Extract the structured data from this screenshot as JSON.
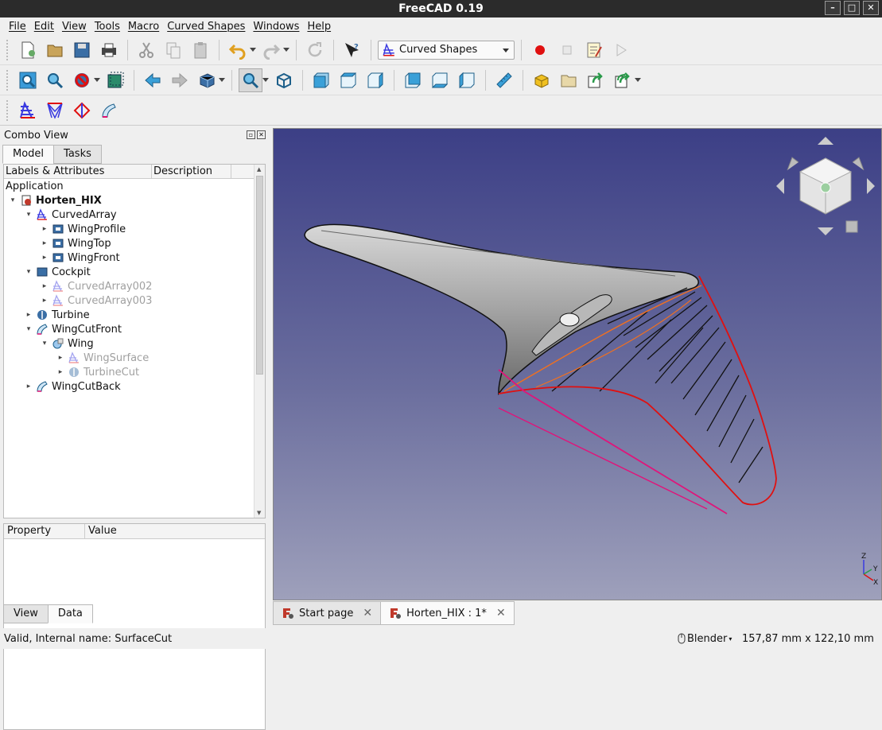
{
  "window": {
    "title": "FreeCAD 0.19",
    "buttons": [
      "–",
      "□",
      "✕"
    ]
  },
  "menubar": [
    "File",
    "Edit",
    "View",
    "Tools",
    "Macro",
    "Curved Shapes",
    "Windows",
    "Help"
  ],
  "toolbar": {
    "workbench_selected": "Curved Shapes"
  },
  "combo_view": {
    "title": "Combo View",
    "tabs": [
      "Model",
      "Tasks"
    ],
    "tree_columns": [
      "Labels & Attributes",
      "Description"
    ],
    "tree_root": "Application",
    "tree_items": [
      {
        "label": "Horten_HIX",
        "level": 0,
        "expander": "▾",
        "icon": "document-icon",
        "state": "bold"
      },
      {
        "label": "CurvedArray",
        "level": 1,
        "expander": "▾",
        "icon": "curved-array-icon",
        "state": "normal"
      },
      {
        "label": "WingProfile",
        "level": 2,
        "expander": "▸",
        "icon": "sketch-icon",
        "state": "normal"
      },
      {
        "label": "WingTop",
        "level": 2,
        "expander": "▸",
        "icon": "sketch-icon",
        "state": "normal"
      },
      {
        "label": "WingFront",
        "level": 2,
        "expander": "▸",
        "icon": "sketch-icon",
        "state": "normal"
      },
      {
        "label": "Cockpit",
        "level": 1,
        "expander": "▾",
        "icon": "part-icon",
        "state": "normal"
      },
      {
        "label": "CurvedArray002",
        "level": 2,
        "expander": "▸",
        "icon": "curved-array-icon",
        "state": "dim"
      },
      {
        "label": "CurvedArray003",
        "level": 2,
        "expander": "▸",
        "icon": "curved-array-icon",
        "state": "dim"
      },
      {
        "label": "Turbine",
        "level": 1,
        "expander": "▸",
        "icon": "revolve-icon",
        "state": "normal"
      },
      {
        "label": "WingCutFront",
        "level": 1,
        "expander": "▾",
        "icon": "surface-cut-icon",
        "state": "normal"
      },
      {
        "label": "Wing",
        "level": 2,
        "expander": "▾",
        "icon": "solid-icon",
        "state": "normal"
      },
      {
        "label": "WingSurface",
        "level": 3,
        "expander": "▸",
        "icon": "curved-array-icon",
        "state": "dim"
      },
      {
        "label": "TurbineCut",
        "level": 3,
        "expander": "▸",
        "icon": "revolve-icon",
        "state": "dim"
      },
      {
        "label": "WingCutBack",
        "level": 1,
        "expander": "▸",
        "icon": "surface-cut-icon",
        "state": "normal"
      }
    ],
    "property_columns": [
      "Property",
      "Value"
    ],
    "bottom_tabs": [
      "View",
      "Data"
    ]
  },
  "doc_tabs": [
    {
      "label": "Start page",
      "icon": "freecad-icon",
      "close": "✕"
    },
    {
      "label": "Horten_HIX : 1*",
      "icon": "freecad-icon",
      "close": "✕"
    }
  ],
  "status": {
    "message": "Valid, Internal name: SurfaceCut",
    "navigation_style": "Blender",
    "dimensions": "157,87 mm x 122,10 mm"
  },
  "axis_labels": {
    "x": "X",
    "y": "Y",
    "z": "Z"
  },
  "colors": {
    "viewport_top": "#3c3f86",
    "viewport_bottom": "#9ea0bb",
    "accent_red": "#e01010",
    "accent_magenta": "#e0147a",
    "accent_orange": "#f07020"
  }
}
